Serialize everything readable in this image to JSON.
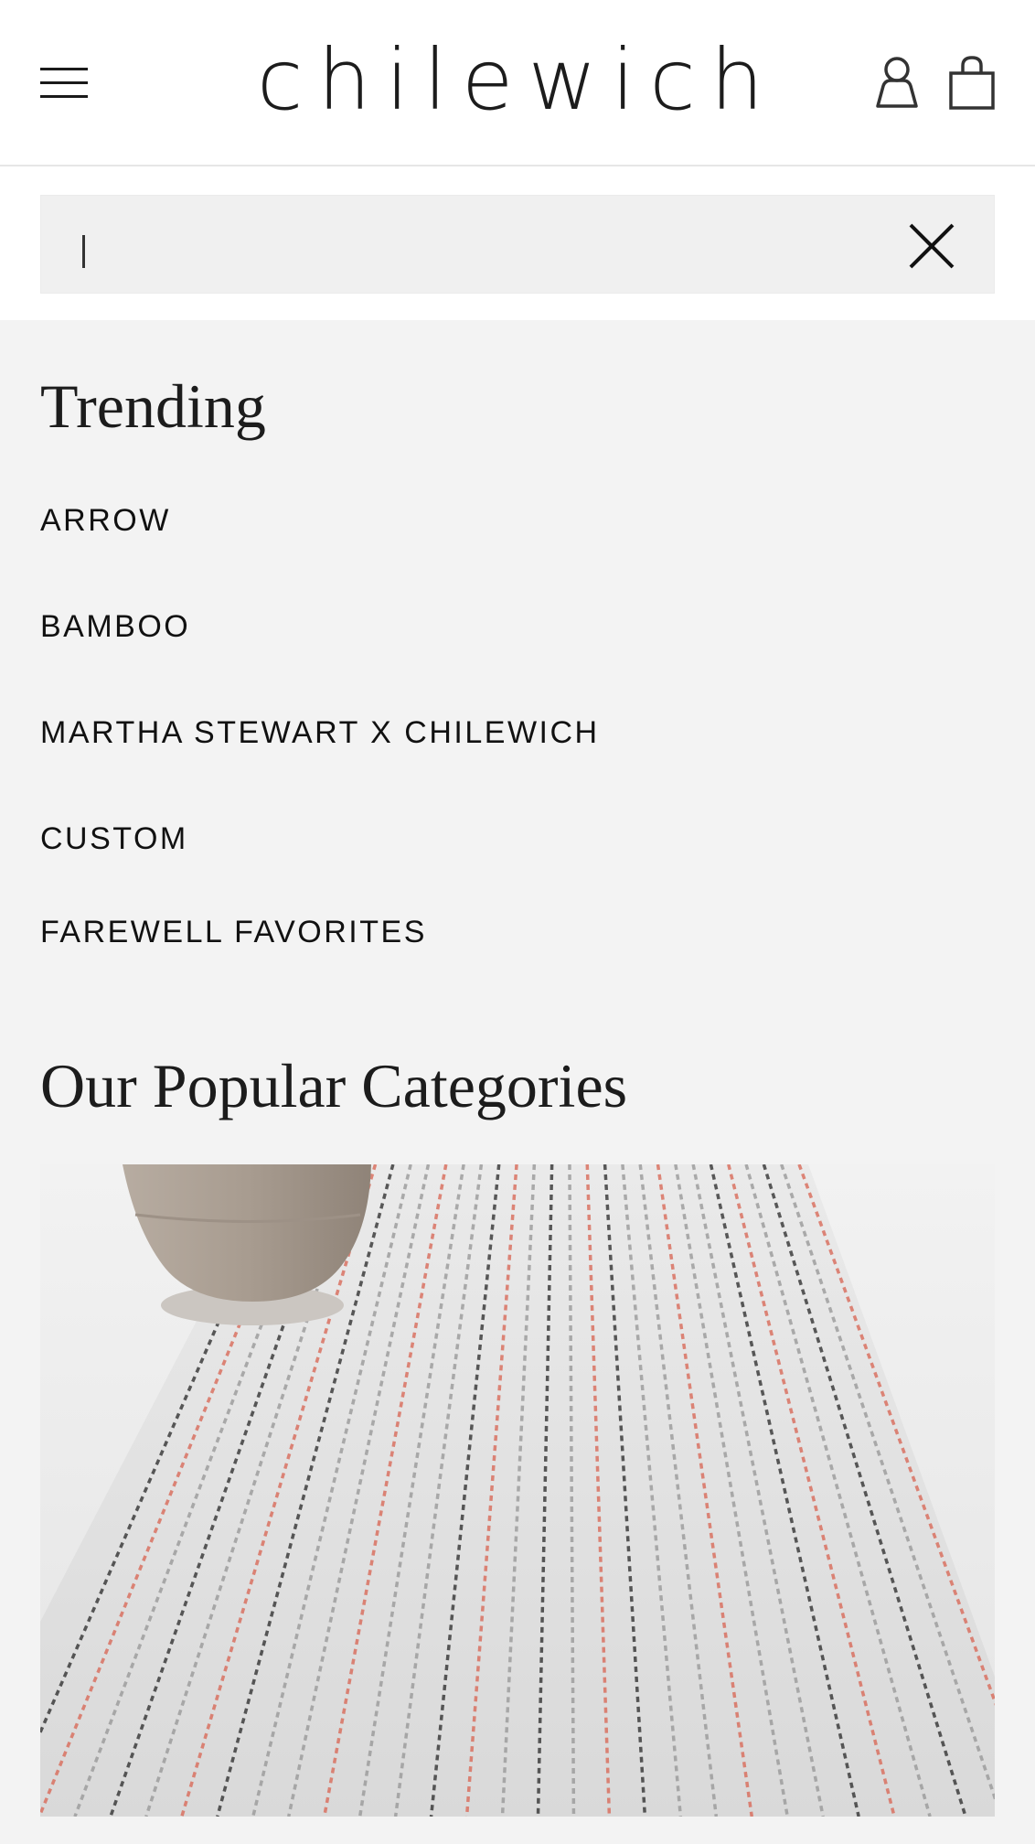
{
  "header": {
    "logo_text": "chilewich",
    "menu_icon": "hamburger-menu-icon",
    "account_icon": "user-icon",
    "cart_icon": "shopping-bag-icon"
  },
  "search": {
    "value": "",
    "placeholder": "",
    "clear_icon": "close-icon"
  },
  "trending": {
    "title": "Trending",
    "items": [
      {
        "label": "ARROW"
      },
      {
        "label": "BAMBOO"
      },
      {
        "label": "MARTHA STEWART X CHILEWICH"
      },
      {
        "label": "CUSTOM"
      },
      {
        "label": "FAREWELL FAVORITES"
      }
    ]
  },
  "categories": {
    "title": "Our Popular Categories",
    "items": [
      {
        "image": "woven-table-runner-with-stoneware-cup"
      }
    ]
  },
  "colors": {
    "page_bg": "#f3f3f3",
    "header_bg": "#ffffff",
    "text": "#1a1a1a",
    "stripe_red": "#d96b5a",
    "stripe_dark": "#333333"
  }
}
